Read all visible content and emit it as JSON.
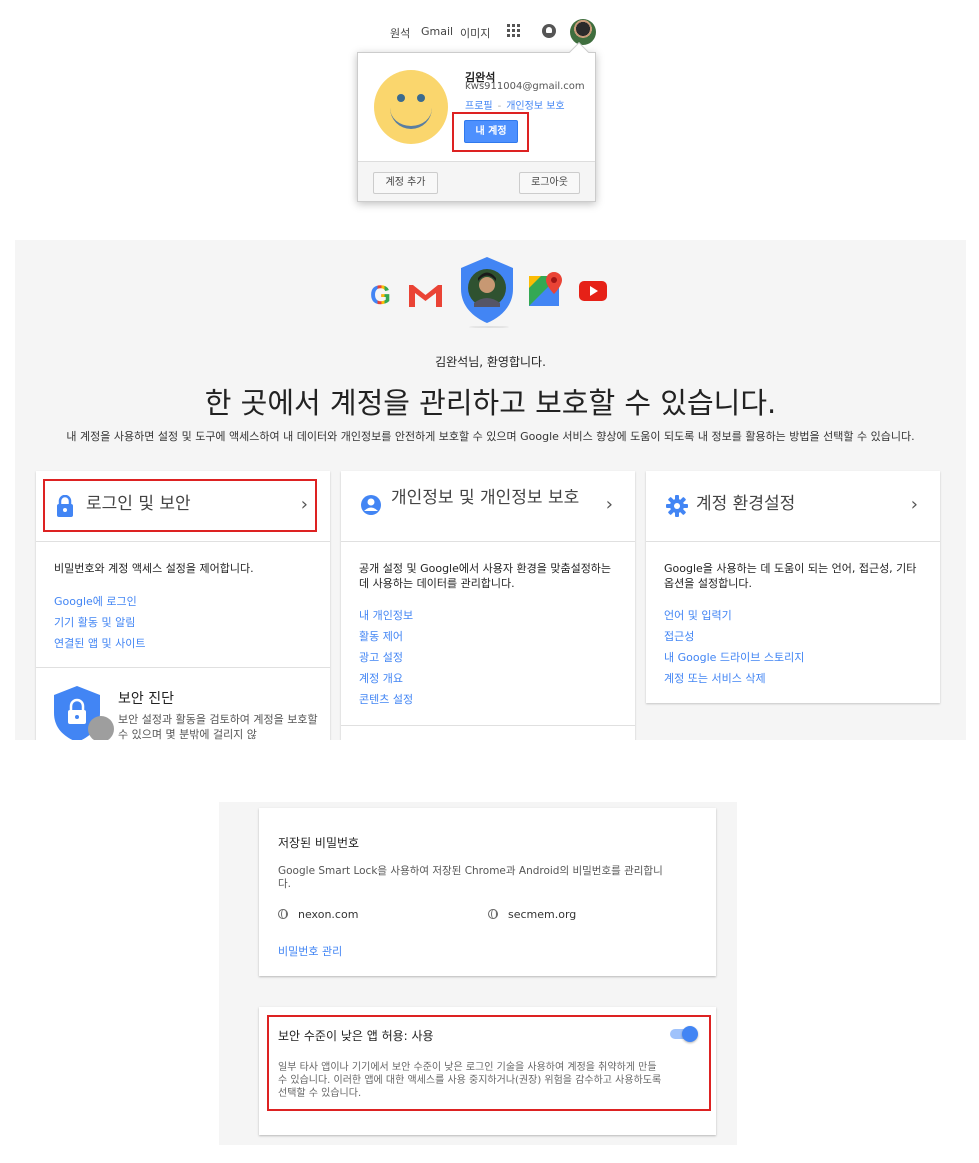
{
  "topbar": {
    "mail": "원석",
    "gmail": "Gmail",
    "images": "이미지"
  },
  "popup": {
    "name": "김완석",
    "email": "kws911004@gmail.com",
    "profile_link": "프로필",
    "separator": "-",
    "privacy_link": "개인정보 보호",
    "my_account_button": "내 계정",
    "add_account_button": "계정 추가",
    "logout_button": "로그아웃"
  },
  "home": {
    "welcome": "김완석님, 환영합니다.",
    "headline": "한 곳에서 계정을 관리하고 보호할 수 있습니다.",
    "subtext": "내 계정을 사용하면 설정 및 도구에 액세스하여 내 데이터와 개인정보를 안전하게 보호할 수 있으며 Google 서비스 향상에 도움이 되도록 내 정보를 활용하는 방법을 선택할 수 있습니다.",
    "cards": [
      {
        "title": "로그인 및 보안",
        "description": "비밀번호와 계정 액세스 설정을 제어합니다.",
        "links": [
          "Google에 로그인",
          "기기 활동 및 알림",
          "연결된 앱 및 사이트"
        ]
      },
      {
        "title": "개인정보 및 개인정보 보호",
        "description": "공개 설정 및 Google에서 사용자 환경을 맞춤설정하는 데 사용하는 데이터를 관리합니다.",
        "links": [
          "내 개인정보",
          "활동 제어",
          "광고 설정",
          "계정 개요",
          "콘텐츠 설정"
        ]
      },
      {
        "title": "계정 환경설정",
        "description": "Google을 사용하는 데 도움이 되는 언어, 접근성, 기타 옵션을 설정합니다.",
        "links": [
          "언어 및 입력기",
          "접근성",
          "내 Google 드라이브 스토리지",
          "계정 또는 서비스 삭제"
        ]
      }
    ],
    "checkup": {
      "title": "보안 진단",
      "description": "보안 설정과 활동을 검토하여 계정을 보호할 수 있으며 몇 분밖에 걸리지 않"
    }
  },
  "settings": {
    "saved_passwords": {
      "title": "저장된 비밀번호",
      "description": "Google Smart Lock을 사용하여 저장된 Chrome과 Android의 비밀번호를 관리합니다.",
      "sites": [
        "nexon.com",
        "secmem.org"
      ],
      "manage_link": "비밀번호 관리"
    },
    "less_secure_apps": {
      "title": "보안 수준이 낮은 앱 허용: 사용",
      "description": "일부 타사 앱이나 기기에서 보안 수준이 낮은 로그인 기술을 사용하여 계정을 취약하게 만들 수 있습니다. 이러한 앱에 대한 액세스를 사용 중지하거나(권장) 위험을 감수하고 사용하도록 선택할 수 있습니다.",
      "enabled": true
    }
  },
  "colors": {
    "accent": "#4285f4",
    "highlight": "#dd2222"
  }
}
